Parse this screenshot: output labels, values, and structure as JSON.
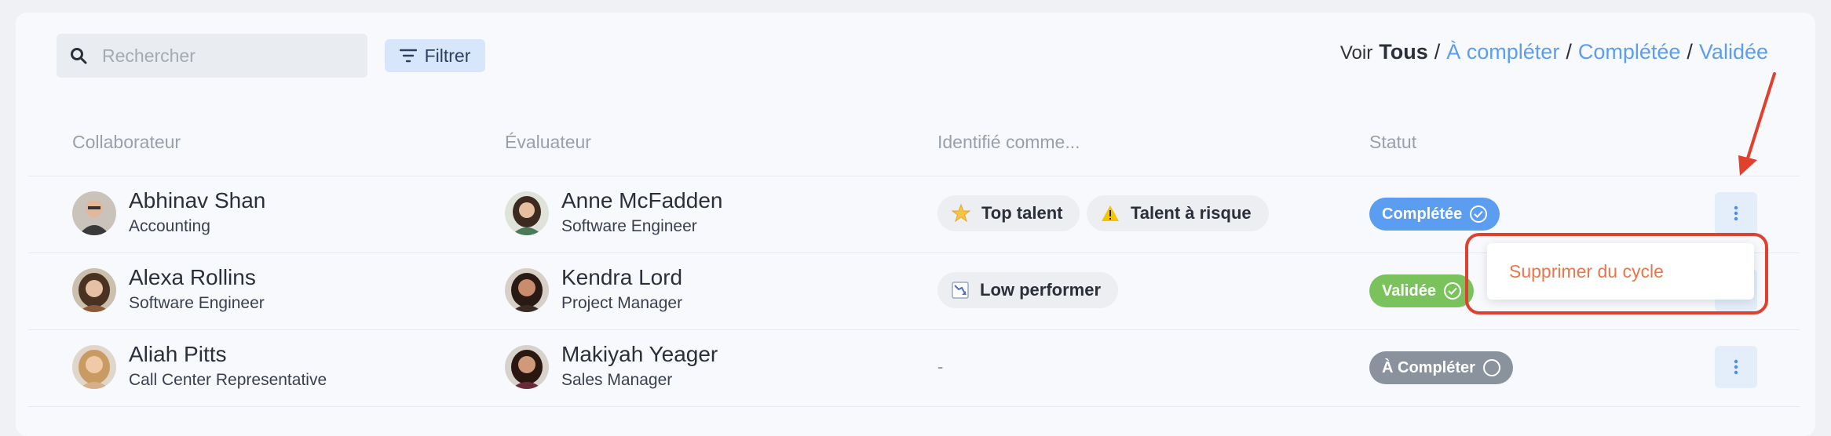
{
  "toolbar": {
    "search_placeholder": "Rechercher",
    "filter_label": "Filtrer",
    "view_prefix": "Voir",
    "view_all": "Tous",
    "view_options": [
      "À compléter",
      "Complétée",
      "Validée"
    ],
    "separator": "/"
  },
  "table": {
    "headers": [
      "Collaborateur",
      "Évaluateur",
      "Identifié comme...",
      "Statut"
    ],
    "rows": [
      {
        "employee": {
          "name": "Abhinav Shan",
          "role": "Accounting"
        },
        "reviewer": {
          "name": "Anne McFadden",
          "role": "Software Engineer"
        },
        "tags": [
          {
            "label": "Top talent",
            "icon": "star-icon"
          },
          {
            "label": "Talent à risque",
            "icon": "warning-icon"
          }
        ],
        "status": {
          "label": "Complétée",
          "color": "#5b9df0",
          "icon": "check-circle-icon"
        }
      },
      {
        "employee": {
          "name": "Alexa Rollins",
          "role": "Software Engineer"
        },
        "reviewer": {
          "name": "Kendra Lord",
          "role": "Project Manager"
        },
        "tags": [
          {
            "label": "Low performer",
            "icon": "chart-down-icon"
          }
        ],
        "status": {
          "label": "Validée",
          "color": "#7ac35c",
          "icon": "check-circle-icon"
        }
      },
      {
        "employee": {
          "name": "Aliah Pitts",
          "role": "Call Center Representative"
        },
        "reviewer": {
          "name": "Makiyah Yeager",
          "role": "Sales Manager"
        },
        "tags_empty": "-",
        "status": {
          "label": "À Compléter",
          "color": "#8a929e",
          "icon": "empty-circle-icon"
        }
      }
    ]
  },
  "context_menu": {
    "item_label": "Supprimer du cycle",
    "item_color": "#e8764a"
  },
  "annotation": {
    "color": "#e0402e"
  }
}
